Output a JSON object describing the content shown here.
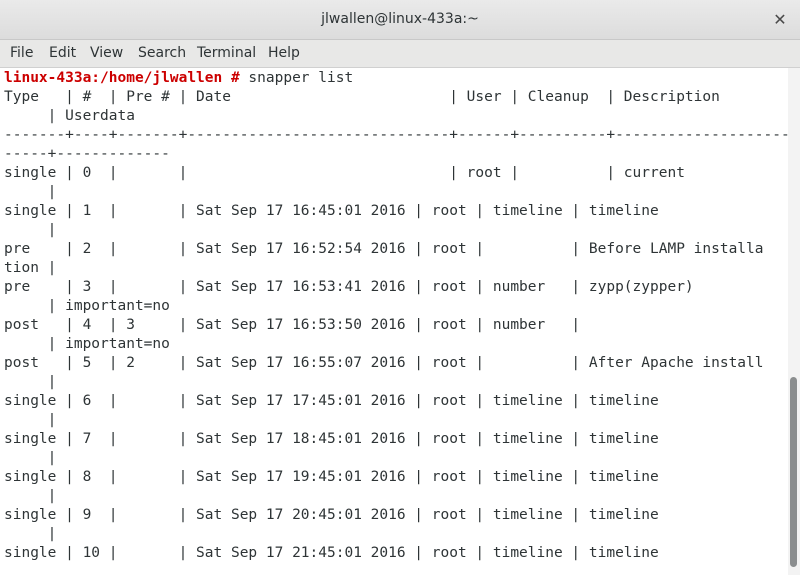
{
  "window": {
    "title": "jlwallen@linux-433a:~",
    "close_glyph": "✕"
  },
  "menubar": {
    "items": [
      "File",
      "Edit",
      "View",
      "Search",
      "Terminal",
      "Help"
    ]
  },
  "terminal": {
    "prompt": "linux-433a:/home/jlwallen #",
    "command": " snapper list",
    "output_lines": [
      "Type   | #  | Pre # | Date                         | User | Cleanup  | Description",
      "     | Userdata",
      "-------+----+-------+------------------------------+------+----------+----------------------",
      "-----+-------------",
      "single | 0  |       |                              | root |          | current",
      "     |",
      "single | 1  |       | Sat Sep 17 16:45:01 2016 | root | timeline | timeline",
      "     |",
      "pre    | 2  |       | Sat Sep 17 16:52:54 2016 | root |          | Before LAMP installa",
      "tion |",
      "pre    | 3  |       | Sat Sep 17 16:53:41 2016 | root | number   | zypp(zypper)",
      "     | important=no",
      "post   | 4  | 3     | Sat Sep 17 16:53:50 2016 | root | number   |",
      "     | important=no",
      "post   | 5  | 2     | Sat Sep 17 16:55:07 2016 | root |          | After Apache install",
      "     |",
      "single | 6  |       | Sat Sep 17 17:45:01 2016 | root | timeline | timeline",
      "     |",
      "single | 7  |       | Sat Sep 17 18:45:01 2016 | root | timeline | timeline",
      "     |",
      "single | 8  |       | Sat Sep 17 19:45:01 2016 | root | timeline | timeline",
      "     |",
      "single | 9  |       | Sat Sep 17 20:45:01 2016 | root | timeline | timeline",
      "     |",
      "single | 10 |       | Sat Sep 17 21:45:01 2016 | root | timeline | timeline"
    ]
  },
  "colors": {
    "prompt": "#cc0000",
    "text": "#2e3436",
    "background": "#ffffff"
  }
}
